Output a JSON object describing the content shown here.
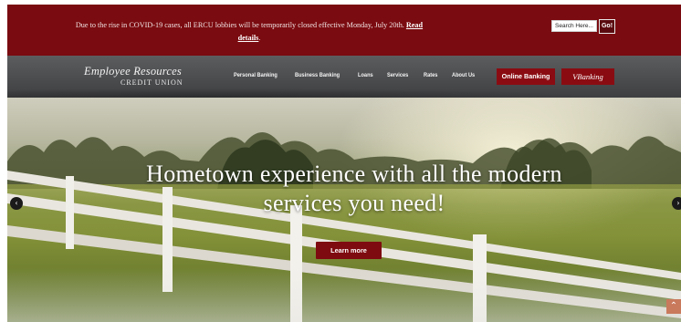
{
  "alert": {
    "message": "Due to the rise in COVID-19 cases, all ERCU lobbies will be temporarily closed effective Monday, July 20th.",
    "link_label": "Read details",
    "trailing": "."
  },
  "search": {
    "placeholder": "Search Here...",
    "button_label": "Go!"
  },
  "brand": {
    "script_name": "Employee Resources",
    "sub_name": "CREDIT UNION"
  },
  "nav": {
    "items": [
      {
        "label": "Personal Banking"
      },
      {
        "label": "Business Banking"
      },
      {
        "label": "Loans"
      },
      {
        "label": "Services"
      },
      {
        "label": "Rates"
      },
      {
        "label": "About Us"
      }
    ],
    "online_banking_label": "Online Banking",
    "vbanking_label": "VBanking"
  },
  "hero": {
    "headline": "Hometown experience with all the modern services you need!",
    "cta_label": "Learn more",
    "prev_icon": "chevron-left-icon",
    "next_icon": "chevron-right-icon"
  },
  "scroll_top_icon": "chevron-up-icon",
  "colors": {
    "brand_red": "#7a0b10",
    "button_red": "#8a0c12",
    "nav_gray": "#4a4b4d"
  }
}
